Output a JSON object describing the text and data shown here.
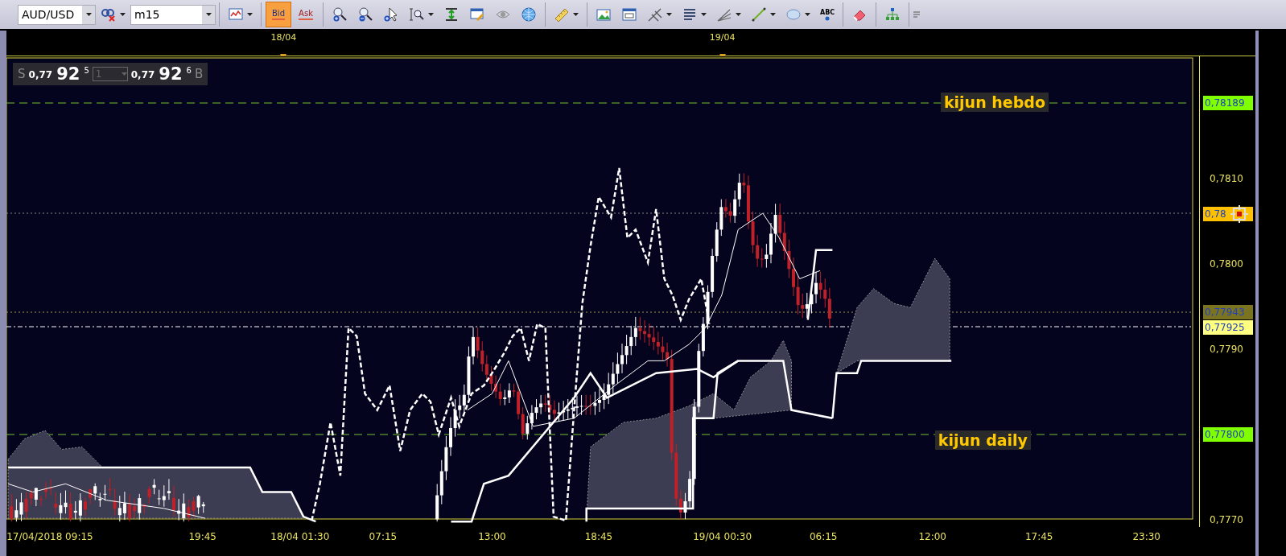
{
  "toolbar": {
    "symbol": "AUD/USD",
    "timeframe": "m15",
    "price_modes": [
      {
        "label": "Bid",
        "selected": true
      },
      {
        "label": "Ask",
        "selected": false
      }
    ],
    "text_tool_label": "ABC"
  },
  "quote_panel": {
    "sell_label": "S",
    "sell_prefix": "0,77",
    "sell_big": "92",
    "sell_pip": "5",
    "quantity": "1",
    "buy_prefix": "0,77",
    "buy_big": "92",
    "buy_pip": "6",
    "buy_label": "B"
  },
  "date_markers": [
    "18/04",
    "19/04"
  ],
  "annotations": [
    {
      "text": "kijun hebdo"
    },
    {
      "text": "kijun daily"
    }
  ],
  "price_axis": {
    "ticks": [
      "0,7810",
      "0,7800",
      "0,7790",
      "0,7770"
    ],
    "tags": [
      {
        "text": "0,78189",
        "color": "#80ff00"
      },
      {
        "text": "0,78",
        "color": "#ffc000"
      },
      {
        "text": "0,77943",
        "color": "#7a7420"
      },
      {
        "text": "0,77925",
        "color": "#ffff80"
      },
      {
        "text": "0,77800",
        "color": "#80ff00"
      }
    ]
  },
  "time_axis": [
    "17/04/2018 09:15",
    "19:45",
    "18/04 01:30",
    "07:15",
    "13:00",
    "18:45",
    "19/04 00:30",
    "06:15",
    "12:00",
    "17:45",
    "23:30"
  ]
}
